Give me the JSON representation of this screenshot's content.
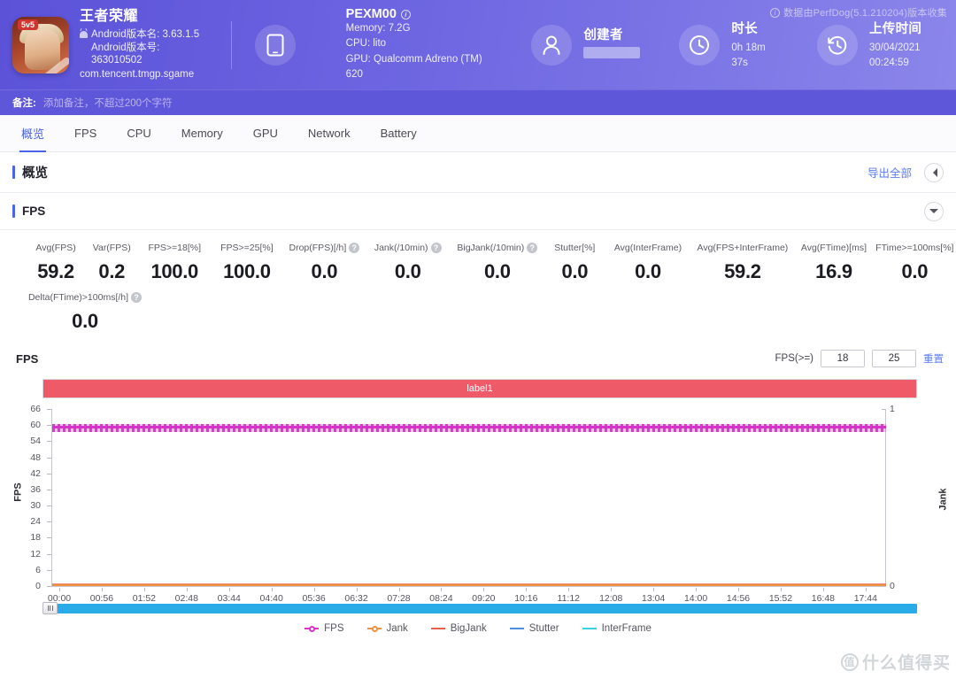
{
  "header": {
    "watermark_note": "数据由PerfDog(5.1.210204)版本收集",
    "app": {
      "name": "王者荣耀",
      "version_name": "Android版本名: 3.63.1.5",
      "version_code": "Android版本号: 363010502",
      "package": "com.tencent.tmgp.sgame"
    },
    "device": {
      "model": "PEXM00",
      "memory": "Memory: 7.2G",
      "cpu": "CPU: lito",
      "gpu": "GPU: Qualcomm Adreno (TM) 620"
    },
    "creator": {
      "label": "创建者",
      "value": ""
    },
    "duration": {
      "label": "时长",
      "value": "0h 18m 37s"
    },
    "upload": {
      "label": "上传时间",
      "value": "30/04/2021 00:24:59"
    }
  },
  "note_bar": {
    "label": "备注:",
    "placeholder": "添加备注，不超过200个字符",
    "value": ""
  },
  "tabs": [
    {
      "label": "概览",
      "active": true
    },
    {
      "label": "FPS",
      "active": false
    },
    {
      "label": "CPU",
      "active": false
    },
    {
      "label": "Memory",
      "active": false
    },
    {
      "label": "GPU",
      "active": false
    },
    {
      "label": "Network",
      "active": false
    },
    {
      "label": "Battery",
      "active": false
    }
  ],
  "section": {
    "title": "概览",
    "export_all": "导出全部",
    "collapse_icon": "triangle-left-icon"
  },
  "fps_card": {
    "title": "FPS",
    "expand_icon": "chevron-down-icon"
  },
  "metrics": [
    {
      "label": "Avg(FPS)",
      "value": "59.2",
      "help": false
    },
    {
      "label": "Var(FPS)",
      "value": "0.2",
      "help": false
    },
    {
      "label": "FPS>=18[%]",
      "value": "100.0",
      "help": false
    },
    {
      "label": "FPS>=25[%]",
      "value": "100.0",
      "help": false
    },
    {
      "label": "Drop(FPS)[/h]",
      "value": "0.0",
      "help": true
    },
    {
      "label": "Jank(/10min)",
      "value": "0.0",
      "help": true
    },
    {
      "label": "BigJank(/10min)",
      "value": "0.0",
      "help": true
    },
    {
      "label": "Stutter[%]",
      "value": "0.0",
      "help": false
    },
    {
      "label": "Avg(InterFrame)",
      "value": "0.0",
      "help": false
    },
    {
      "label": "Avg(FPS+InterFrame)",
      "value": "59.2",
      "help": false
    },
    {
      "label": "Avg(FTime)[ms]",
      "value": "16.9",
      "help": false
    },
    {
      "label": "FTime>=100ms[%]",
      "value": "0.0",
      "help": false
    }
  ],
  "metrics_row2": [
    {
      "label": "Delta(FTime)>100ms[/h]",
      "value": "0.0",
      "help": true
    }
  ],
  "chart_controls": {
    "name": "FPS",
    "threshold_label": "FPS(>=)",
    "threshold_low": "18",
    "threshold_high": "25",
    "reset": "重置"
  },
  "chart_data": {
    "type": "line",
    "title": "FPS",
    "label_band": "label1",
    "xlabel": "",
    "ylabel": "FPS",
    "y2label": "Jank",
    "ylim": [
      0,
      66
    ],
    "y2lim": [
      0,
      1
    ],
    "yticks": [
      0,
      6,
      12,
      18,
      24,
      30,
      36,
      42,
      48,
      54,
      60,
      66
    ],
    "y2ticks": [
      0,
      1
    ],
    "xticks": [
      "00:00",
      "00:56",
      "01:52",
      "02:48",
      "03:44",
      "04:40",
      "05:36",
      "06:32",
      "07:28",
      "08:24",
      "09:20",
      "10:16",
      "11:12",
      "12:08",
      "13:04",
      "14:00",
      "14:56",
      "15:52",
      "16:48",
      "17:44"
    ],
    "grid": false,
    "legend_position": "bottom",
    "series": [
      {
        "name": "FPS",
        "color": "#d633c7",
        "style": "dotted-line",
        "mean": 59.2,
        "min": 57,
        "max": 60,
        "values": [
          59,
          60,
          59,
          60,
          59,
          59,
          60,
          59,
          60,
          59,
          59,
          60,
          59,
          60,
          59,
          59,
          60,
          59,
          60,
          59,
          59,
          60,
          59,
          60,
          59,
          59,
          60,
          59,
          60,
          59
        ]
      },
      {
        "name": "Jank",
        "color": "#f0923c",
        "style": "line",
        "mean": 0.0,
        "values": [
          0,
          0,
          0,
          0,
          0,
          0,
          0,
          0,
          0,
          0,
          0,
          0,
          0,
          0,
          0,
          0,
          0,
          0,
          0,
          0,
          0,
          0,
          0,
          0,
          0,
          0,
          0,
          0,
          0,
          0
        ]
      },
      {
        "name": "BigJank",
        "color": "#e8604e",
        "style": "line",
        "mean": 0.0,
        "values": [
          0,
          0,
          0,
          0,
          0,
          0,
          0,
          0,
          0,
          0,
          0,
          0,
          0,
          0,
          0,
          0,
          0,
          0,
          0,
          0,
          0,
          0,
          0,
          0,
          0,
          0,
          0,
          0,
          0,
          0
        ]
      },
      {
        "name": "Stutter",
        "color": "#4a8fe0",
        "style": "line",
        "mean": 0.0,
        "values": [
          0,
          0,
          0,
          0,
          0,
          0,
          0,
          0,
          0,
          0,
          0,
          0,
          0,
          0,
          0,
          0,
          0,
          0,
          0,
          0,
          0,
          0,
          0,
          0,
          0,
          0,
          0,
          0,
          0,
          0
        ]
      },
      {
        "name": "InterFrame",
        "color": "#3ccfe0",
        "style": "line",
        "mean": 0.0,
        "values": [
          0,
          0,
          0,
          0,
          0,
          0,
          0,
          0,
          0,
          0,
          0,
          0,
          0,
          0,
          0,
          0,
          0,
          0,
          0,
          0,
          0,
          0,
          0,
          0,
          0,
          0,
          0,
          0,
          0,
          0
        ]
      }
    ]
  },
  "legend": [
    {
      "label": "FPS",
      "color": "#d633c7",
      "marker": true
    },
    {
      "label": "Jank",
      "color": "#f0923c",
      "marker": true
    },
    {
      "label": "BigJank",
      "color": "#e8604e",
      "marker": false
    },
    {
      "label": "Stutter",
      "color": "#4a8fe0",
      "marker": false
    },
    {
      "label": "InterFrame",
      "color": "#3ccfe0",
      "marker": false
    }
  ],
  "site_watermark": "什么值得买",
  "colors": {
    "brand_purple": "#5f57da",
    "accent_blue": "#4a63e7",
    "link_blue": "#5b7cfa",
    "label_band": "#ef5a68",
    "scrollbar": "#29abe8"
  }
}
